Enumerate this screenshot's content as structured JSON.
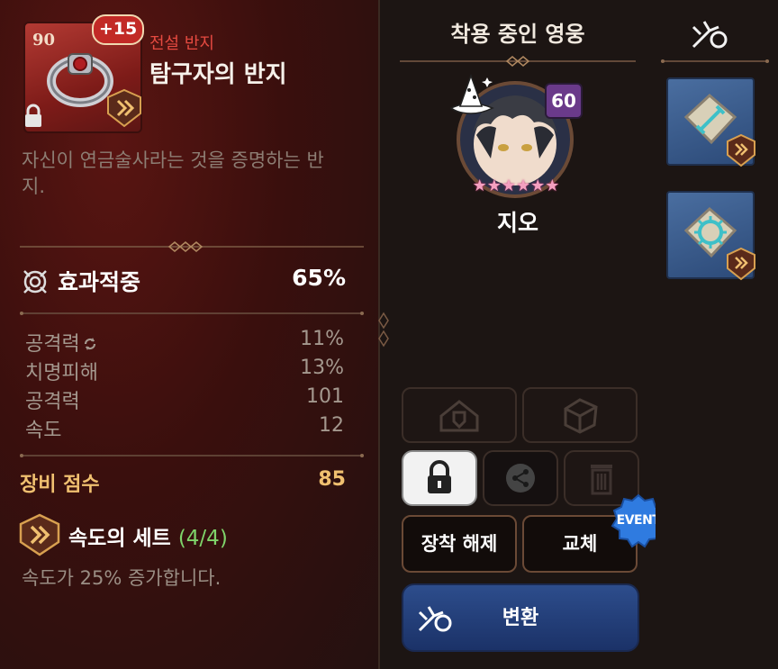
{
  "item": {
    "level": "90",
    "enhance": "+15",
    "grade": "전설 반지",
    "name": "탐구자의 반지",
    "description": "자신이 연금술사라는 것을 증명하는 반지."
  },
  "main_stat": {
    "label": "효과적중",
    "value": "65%"
  },
  "sub_stats": [
    {
      "label": "공격력",
      "value": "11%",
      "reforged": true
    },
    {
      "label": "치명피해",
      "value": "13%"
    },
    {
      "label": "공격력",
      "value": "101"
    },
    {
      "label": "속도",
      "value": "12"
    }
  ],
  "score": {
    "label": "장비 점수",
    "value": "85"
  },
  "set": {
    "name": "속도의 세트",
    "count": "(4/4)",
    "description": "속도가 25% 증가합니다."
  },
  "equipped": {
    "title": "착용 중인 영웅",
    "hero_name": "지오",
    "hero_level": "60",
    "stars": 6
  },
  "actions": {
    "unequip": "장착 해제",
    "replace": "교체",
    "event": "EVENT",
    "convert": "변환"
  },
  "colors": {
    "grade_red": "#e54a40",
    "set_green": "#7fd46a",
    "score_gold": "#f0c070",
    "convert_blue": "#2d4d8c"
  }
}
